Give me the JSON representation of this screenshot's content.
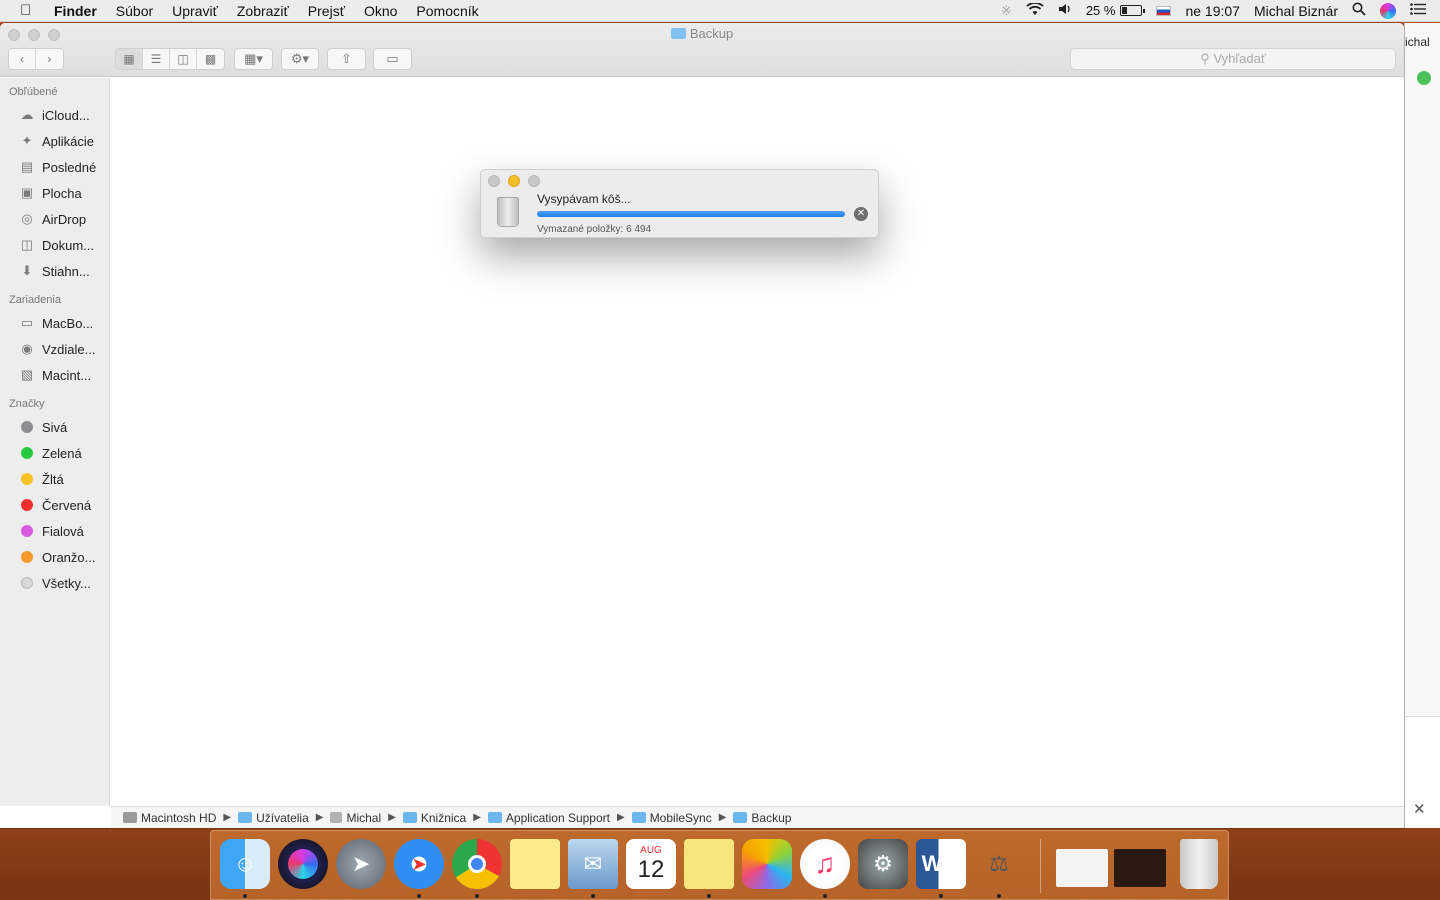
{
  "menubar": {
    "app_name": "Finder",
    "items": [
      "Súbor",
      "Upraviť",
      "Zobraziť",
      "Prejsť",
      "Okno",
      "Pomocník"
    ],
    "battery": "25 %",
    "clock": "ne 19:07",
    "user": "Michal Biznár"
  },
  "window": {
    "title": "Backup",
    "search_placeholder": "Vyhľadať"
  },
  "sidebar": {
    "favorites_heading": "Obľúbené",
    "favorites": [
      {
        "label": "iCloud...",
        "icon": "cloud-icon"
      },
      {
        "label": "Aplikácie",
        "icon": "applications-icon"
      },
      {
        "label": "Posledné",
        "icon": "recents-icon"
      },
      {
        "label": "Plocha",
        "icon": "desktop-icon"
      },
      {
        "label": "AirDrop",
        "icon": "airdrop-icon"
      },
      {
        "label": "Dokum...",
        "icon": "documents-icon"
      },
      {
        "label": "Stiahn...",
        "icon": "downloads-icon"
      }
    ],
    "devices_heading": "Zariadenia",
    "devices": [
      {
        "label": "MacBo...",
        "icon": "laptop-icon"
      },
      {
        "label": "Vzdiale...",
        "icon": "remote-disc-icon"
      },
      {
        "label": "Macint...",
        "icon": "hard-drive-icon"
      }
    ],
    "tags_heading": "Značky",
    "tags": [
      {
        "label": "Sivá",
        "color": "#8e8e93"
      },
      {
        "label": "Zelená",
        "color": "#28c840"
      },
      {
        "label": "Žltá",
        "color": "#f5c326"
      },
      {
        "label": "Červená",
        "color": "#ef2f2f"
      },
      {
        "label": "Fialová",
        "color": "#d85ce0"
      },
      {
        "label": "Oranžo...",
        "color": "#f59a2c"
      },
      {
        "label": "Všetky...",
        "color": "#d8d8d8"
      }
    ]
  },
  "dialog": {
    "title": "Vysypávam kôš...",
    "progress": 1.0,
    "status": "Vymazané položky: 6 494"
  },
  "pathbar": [
    "Macintosh HD",
    "Užívatelia",
    "Michal",
    "Knižnica",
    "Application Support",
    "MobileSync",
    "Backup"
  ],
  "background_window": {
    "name_fragment": "ichal"
  },
  "dock": {
    "calendar_month": "AUG",
    "calendar_day": "12",
    "word_letter": "W"
  }
}
